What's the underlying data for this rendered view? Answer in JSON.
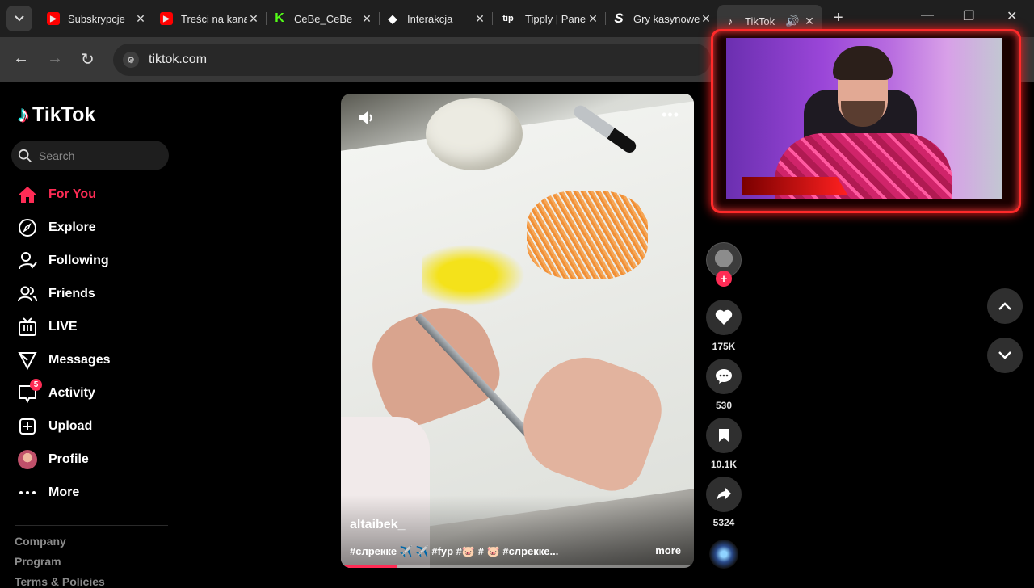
{
  "browser": {
    "tabs": [
      {
        "title": "Subskrypcje",
        "favicon": "youtube-icon",
        "color": "#ff0000"
      },
      {
        "title": "Treści na kanale",
        "favicon": "youtube-studio-icon",
        "color": "#ff0000"
      },
      {
        "title": "CeBe_CeBe",
        "favicon": "kick-icon",
        "color": "#53fc18"
      },
      {
        "title": "Interakcja",
        "favicon": "diamond-icon",
        "color": "#ffffff"
      },
      {
        "title": "Tipply | Panel",
        "favicon": "tipply-icon",
        "color": "#ffffff"
      },
      {
        "title": "Gry kasynowe",
        "favicon": "stake-icon",
        "color": "#ffffff"
      },
      {
        "title": "TikTok",
        "favicon": "tiktok-icon",
        "color": "#ffffff"
      }
    ],
    "url": "tiktok.com"
  },
  "sidebar": {
    "brand": "TikTok",
    "search_placeholder": "Search",
    "items": [
      {
        "label": "For You",
        "icon": "home-icon"
      },
      {
        "label": "Explore",
        "icon": "compass-icon"
      },
      {
        "label": "Following",
        "icon": "following-icon"
      },
      {
        "label": "Friends",
        "icon": "friends-icon"
      },
      {
        "label": "LIVE",
        "icon": "live-icon"
      },
      {
        "label": "Messages",
        "icon": "send-icon"
      },
      {
        "label": "Activity",
        "icon": "activity-icon",
        "badge": "5"
      },
      {
        "label": "Upload",
        "icon": "upload-icon"
      },
      {
        "label": "Profile",
        "icon": "profile-avatar"
      },
      {
        "label": "More",
        "icon": "more-icon"
      }
    ],
    "footer": [
      "Company",
      "Program",
      "Terms & Policies"
    ]
  },
  "video": {
    "author": "altaibek_",
    "caption": "#слрекке ✈️ ✈️ #fyp #🐷 # 🐷 #слрекке...",
    "more_label": "more",
    "progress": 0.16
  },
  "actions": {
    "likes": "175K",
    "comments": "530",
    "saves": "10.1K",
    "shares": "5324"
  },
  "colors": {
    "accent": "#fe2c55",
    "background": "#000000",
    "button_bg": "#2f2f2f"
  }
}
